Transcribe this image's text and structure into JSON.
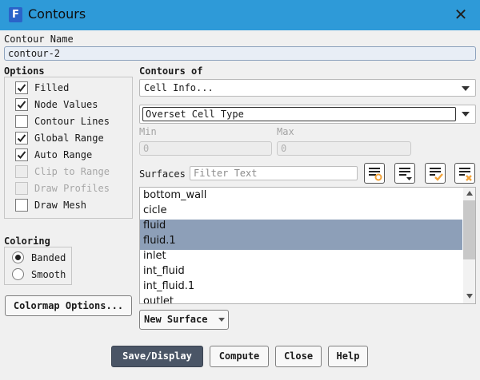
{
  "window": {
    "title": "Contours",
    "app_icon_letter": "F"
  },
  "contour_name": {
    "label": "Contour Name",
    "value": "contour-2"
  },
  "options": {
    "label": "Options",
    "items": [
      {
        "label": "Filled",
        "checked": true,
        "enabled": true
      },
      {
        "label": "Node Values",
        "checked": true,
        "enabled": true
      },
      {
        "label": "Contour Lines",
        "checked": false,
        "enabled": true
      },
      {
        "label": "Global Range",
        "checked": true,
        "enabled": true
      },
      {
        "label": "Auto Range",
        "checked": true,
        "enabled": true
      },
      {
        "label": "Clip to Range",
        "checked": false,
        "enabled": false
      },
      {
        "label": "Draw Profiles",
        "checked": false,
        "enabled": false
      },
      {
        "label": "Draw Mesh",
        "checked": false,
        "enabled": true
      }
    ]
  },
  "coloring": {
    "label": "Coloring",
    "items": [
      {
        "label": "Banded",
        "selected": true
      },
      {
        "label": "Smooth",
        "selected": false
      }
    ]
  },
  "colormap_button": "Colormap Options...",
  "contours_of": {
    "label": "Contours of",
    "category": "Cell Info...",
    "field": "Overset Cell Type"
  },
  "range": {
    "min_label": "Min",
    "min_value": "0",
    "max_label": "Max",
    "max_value": "0"
  },
  "surfaces": {
    "label": "Surfaces",
    "filter_placeholder": "Filter Text",
    "items": [
      {
        "label": "bottom_wall",
        "selected": false
      },
      {
        "label": "cicle",
        "selected": false
      },
      {
        "label": "fluid",
        "selected": true
      },
      {
        "label": "fluid.1",
        "selected": true
      },
      {
        "label": "inlet",
        "selected": false
      },
      {
        "label": "int_fluid",
        "selected": false
      },
      {
        "label": "int_fluid.1",
        "selected": false
      },
      {
        "label": "outlet",
        "selected": false
      }
    ]
  },
  "new_surface_button": "New Surface",
  "footer": {
    "save_display": "Save/Display",
    "compute": "Compute",
    "close": "Close",
    "help": "Help"
  },
  "colors": {
    "titlebar": "#2e9ad8",
    "selection": "#8d9fb8",
    "primary_button": "#4a5566",
    "textbox_bg": "#e8eef6",
    "check_accent": "#f2a33a"
  }
}
